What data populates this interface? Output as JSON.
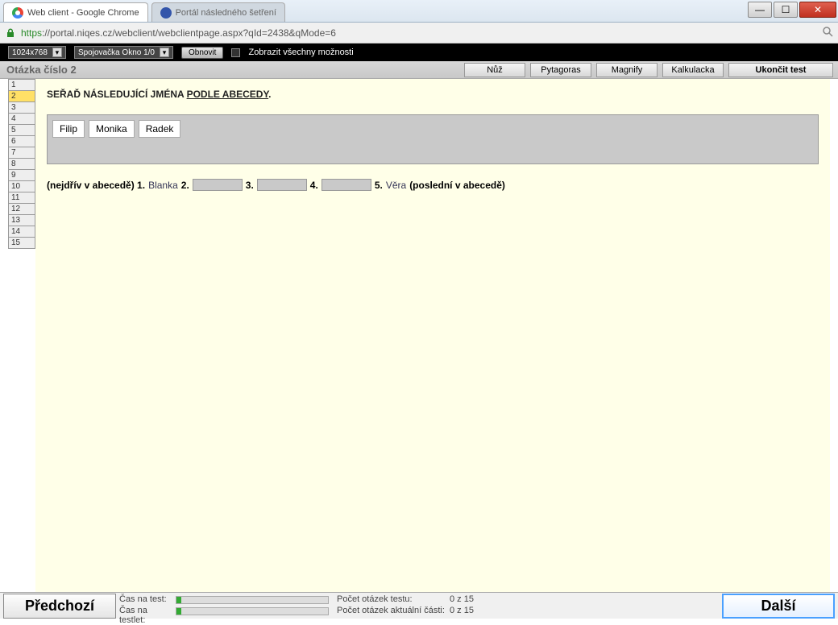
{
  "chrome": {
    "tab1_title": "Web client - Google Chrome",
    "tab2_title": "Portál následného šetření",
    "url_secure": "https",
    "url_rest": "://portal.niqes.cz/webclient/webclientpage.aspx?qId=2438&qMode=6"
  },
  "blackbar": {
    "resolution": "1024x768",
    "window_select": "Spojovačka Okno 1/0",
    "refresh_label": "Obnovit",
    "show_all_label": "Zobrazit všechny možnosti"
  },
  "header": {
    "title": "Otázka číslo 2",
    "btn_nuz": "Nůž",
    "btn_pytagoras": "Pytagoras",
    "btn_magnify": "Magnify",
    "btn_kalk": "Kalkulacka",
    "btn_end": "Ukončit test"
  },
  "nav": {
    "items": [
      "1",
      "2",
      "3",
      "4",
      "5",
      "6",
      "7",
      "8",
      "9",
      "10",
      "11",
      "12",
      "13",
      "14",
      "15"
    ],
    "active_index": 1
  },
  "question": {
    "instruction_prefix": "SEŘAĎ NÁSLEDUJÍCÍ JMÉNA ",
    "instruction_underlined": "PODLE ABECEDY",
    "instruction_suffix": ".",
    "chips": [
      "Filip",
      "Monika",
      "Radek"
    ],
    "answer": {
      "lead": "(nejdřív v abecedě) 1.",
      "fixed1": "Blanka",
      "n2": "2.",
      "n3": "3.",
      "n4": "4.",
      "n5": "5.",
      "fixed5": "Věra",
      "tail": "(poslední v abecedě)"
    }
  },
  "footer": {
    "prev": "Předchozí",
    "next": "Další",
    "time_test_lbl": "Čas na test:",
    "time_testlet_lbl": "Čas na testlet:",
    "count_test_lbl": "Počet otázek testu:",
    "count_part_lbl": "Počet otázek aktuální části:",
    "count_test_val": "0 z 15",
    "count_part_val": "0 z 15"
  }
}
